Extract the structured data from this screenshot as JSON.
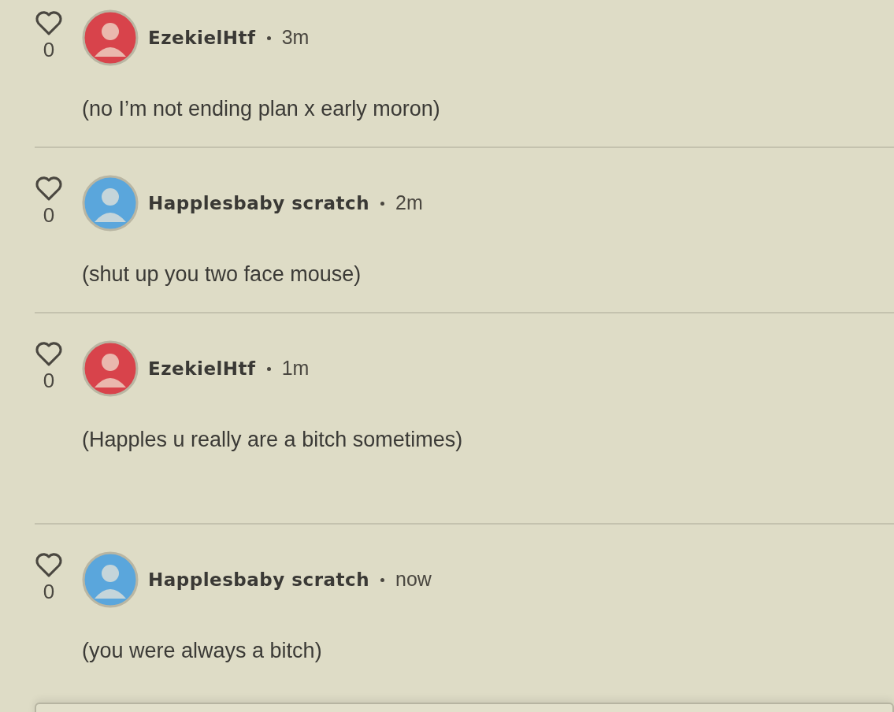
{
  "comments": [
    {
      "likes": "0",
      "liked": false,
      "author": "EzekielHtf",
      "color": "#d8434b",
      "time": "3m",
      "message": "(no I’m not ending plan x early moron)"
    },
    {
      "likes": "0",
      "liked": false,
      "author": "Happlesbaby scratch",
      "color": "#5aa6dc",
      "time": "2m",
      "message": "(shut up you two face mouse)"
    },
    {
      "likes": "0",
      "liked": false,
      "author": "EzekielHtf",
      "color": "#d8434b",
      "time": "1m",
      "message": "(Happles u really are a bitch sometimes)"
    },
    {
      "likes": "0",
      "liked": false,
      "author": "Happlesbaby scratch",
      "color": "#5aa6dc",
      "time": "now",
      "message": "(you were always a bitch)"
    }
  ]
}
